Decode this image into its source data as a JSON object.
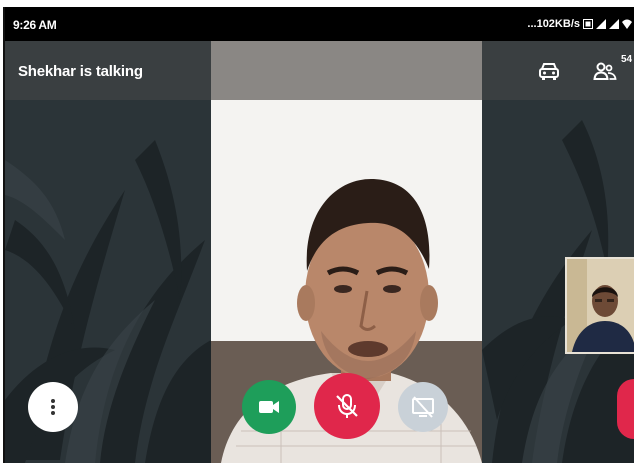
{
  "status_bar": {
    "time": "9:26 AM",
    "net_speed": "...102KB/s"
  },
  "call": {
    "talking_label": "Shekhar is talking",
    "participants_count": "54"
  },
  "icons": {
    "car": "car-icon",
    "people": "people-icon",
    "more": "more-vert-icon",
    "camera": "videocam-icon",
    "mic": "mic-off-icon",
    "present": "present-screen-off-icon"
  },
  "colors": {
    "camera_button": "#1e9e5a",
    "mic_button": "#e0274b",
    "present_button": "#c9d1d8",
    "end_button": "#e0274b",
    "status_bar": "#000000",
    "call_bar": "#3a3f41"
  }
}
